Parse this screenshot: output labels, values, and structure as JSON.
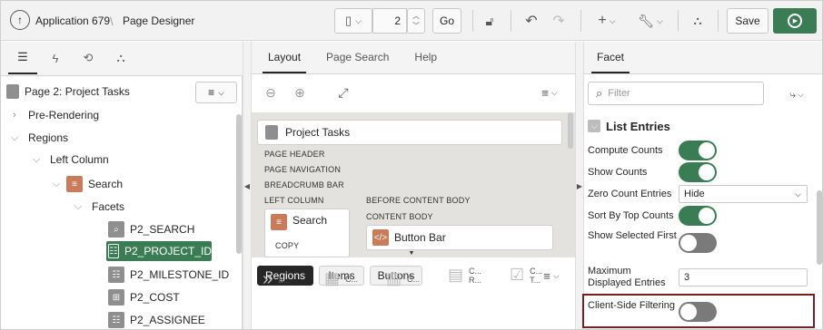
{
  "header": {
    "app_label": "Application 679",
    "separator": "\\",
    "page_title": "Page Designer",
    "page_number": "2",
    "go_label": "Go",
    "save_label": "Save"
  },
  "left_panel": {
    "page_label": "Page 2: Project Tasks",
    "tree": {
      "pre_rendering": "Pre-Rendering",
      "regions": "Regions",
      "left_column": "Left Column",
      "search": "Search",
      "facets": "Facets",
      "items": [
        "P2_SEARCH",
        "P2_PROJECT_ID",
        "P2_MILESTONE_ID",
        "P2_COST",
        "P2_ASSIGNEE"
      ]
    }
  },
  "center_panel": {
    "tabs": [
      "Layout",
      "Page Search",
      "Help"
    ],
    "page_card": "Project Tasks",
    "labels": {
      "page_header": "PAGE HEADER",
      "page_navigation": "PAGE NAVIGATION",
      "breadcrumb_bar": "BREADCRUMB BAR",
      "left_column": "LEFT COLUMN",
      "before_content": "BEFORE CONTENT BODY",
      "content_body": "CONTENT BODY",
      "copy": "COPY"
    },
    "search_card": "Search",
    "button_bar_card": "Button Bar",
    "bottom_tabs": [
      "Regions",
      "Items",
      "Buttons"
    ],
    "gallery": [
      "B...",
      "C...",
      "C...",
      "C...\nR...",
      "C...\nT..."
    ]
  },
  "right_panel": {
    "tab": "Facet",
    "filter_placeholder": "Filter",
    "section_title": "List Entries",
    "props": [
      {
        "label": "Compute Counts",
        "type": "toggle",
        "value": "on"
      },
      {
        "label": "Show Counts",
        "type": "toggle",
        "value": "on"
      },
      {
        "label": "Zero Count Entries",
        "type": "select",
        "value": "Hide"
      },
      {
        "label": "Sort By Top Counts",
        "type": "toggle",
        "value": "on"
      },
      {
        "label": "Show Selected First",
        "type": "toggle",
        "value": "off"
      },
      {
        "label": "Maximum Displayed Entries",
        "type": "text",
        "value": "3"
      },
      {
        "label": "Client-Side Filtering",
        "type": "toggle",
        "value": "off"
      }
    ]
  },
  "colors": {
    "accent_green": "#3a7d55",
    "highlight_border": "#7a1f1f",
    "toggle_off": "#7a7a7a"
  }
}
